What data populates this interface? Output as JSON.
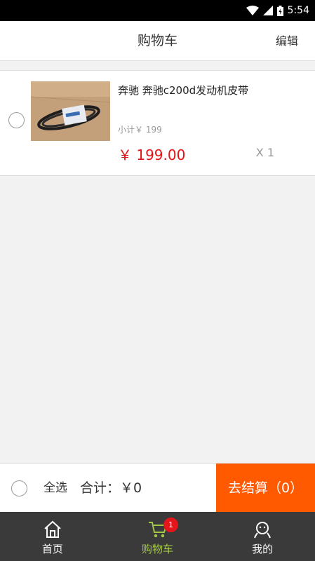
{
  "status_bar": {
    "time": "5:54"
  },
  "header": {
    "title": "购物车",
    "edit_label": "编辑"
  },
  "cart": {
    "items": [
      {
        "name": "奔驰 奔驰c200d发动机皮带",
        "subtotal": "小计￥ 199",
        "price": "￥ 199.00",
        "quantity": "X 1",
        "selected": false
      }
    ]
  },
  "footer": {
    "select_all_label": "全选",
    "total_label": "合计：￥0",
    "checkout_label": "去结算（0）"
  },
  "tabbar": {
    "tabs": [
      {
        "label": "首页",
        "icon": "home-icon",
        "active": false
      },
      {
        "label": "购物车",
        "icon": "cart-icon",
        "active": true,
        "badge": "1"
      },
      {
        "label": "我的",
        "icon": "user-icon",
        "active": false
      }
    ]
  },
  "colors": {
    "accent_orange": "#ff5a00",
    "price_red": "#e41414",
    "active_tab_green": "#a3c744",
    "badge_red": "#e5161b",
    "tabbar_bg": "#3a3a3a"
  }
}
